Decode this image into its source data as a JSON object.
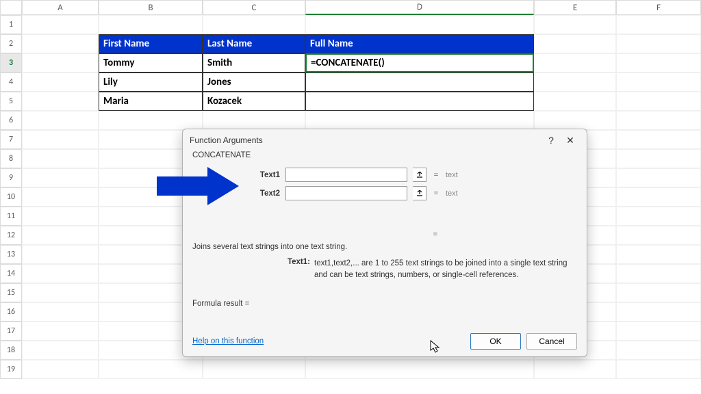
{
  "columns": [
    "A",
    "B",
    "C",
    "D",
    "E",
    "F"
  ],
  "rows": [
    "1",
    "2",
    "3",
    "4",
    "5",
    "6",
    "7",
    "8",
    "9",
    "10",
    "11",
    "12",
    "13",
    "14",
    "15",
    "16",
    "17",
    "18",
    "19"
  ],
  "table": {
    "headers": [
      "First Name",
      "Last Name",
      "Full Name"
    ],
    "r1": [
      "Tommy",
      "Smith",
      "=CONCATENATE()"
    ],
    "r2": [
      "Lily",
      "Jones",
      ""
    ],
    "r3": [
      "Maria",
      "Kozacek",
      ""
    ]
  },
  "dialog": {
    "title": "Function Arguments",
    "func": "CONCATENATE",
    "args": [
      {
        "label": "Text1",
        "value": "",
        "result": "text"
      },
      {
        "label": "Text2",
        "value": "",
        "result": "text"
      }
    ],
    "eq": "=",
    "description": "Joins several text strings into one text string.",
    "arg_desc_label": "Text1:",
    "arg_desc_text": "text1,text2,... are 1 to 255 text strings to be joined into a single text string and can be text strings, numbers, or single-cell references.",
    "formula_result_label": "Formula result =",
    "help_link": "Help on this function",
    "ok": "OK",
    "cancel": "Cancel",
    "help_char": "?",
    "close_char": "✕"
  }
}
